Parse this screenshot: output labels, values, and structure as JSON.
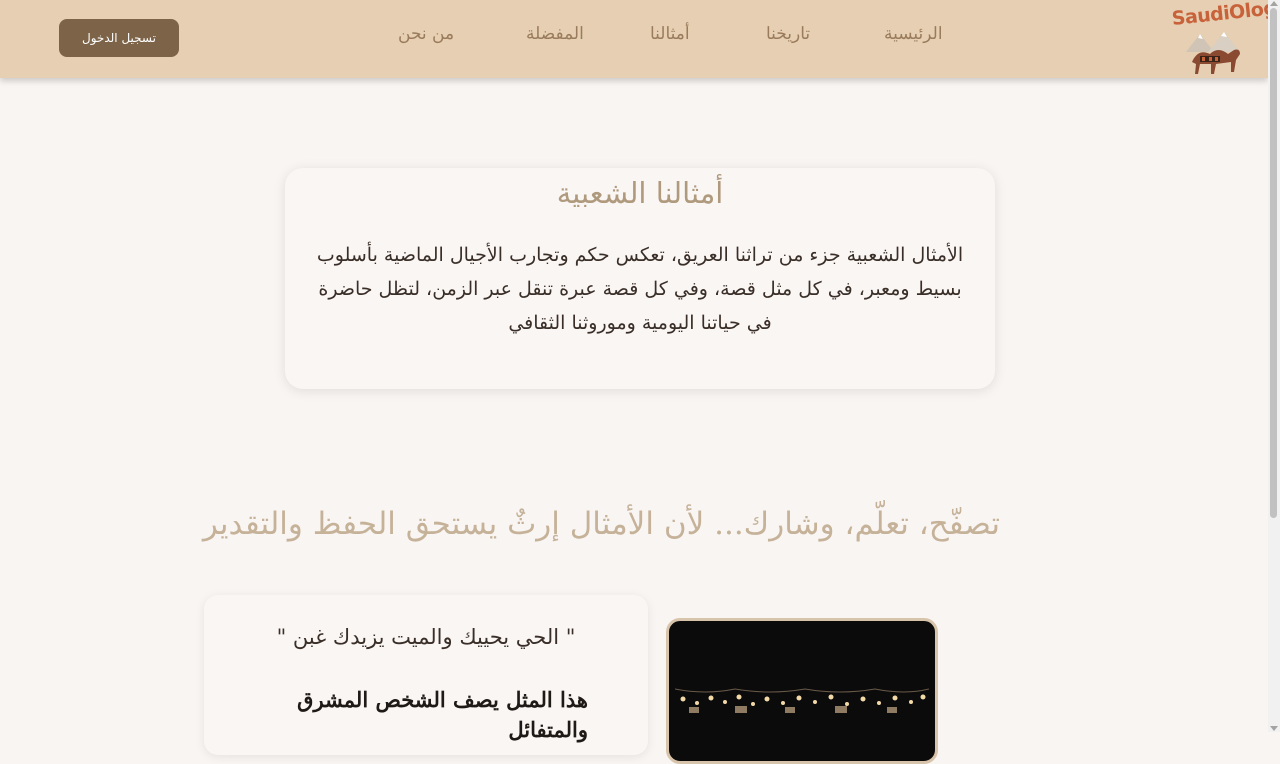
{
  "header": {
    "login_label": "تسجيل الدخول",
    "nav": [
      "من نحن",
      "المفضلة",
      "أمثالنا",
      "تاريخنا",
      "الرئيسية"
    ],
    "logo_text": "SaudiOlogy"
  },
  "intro": {
    "title": "أمثالنا الشعبية",
    "text": "الأمثال الشعبية جزء من تراثنا العريق، تعكس حكم وتجارب الأجيال الماضية بأسلوب بسيط ومعبر، في كل مثل قصة، وفي كل قصة عبرة تنقل عبر الزمن، لتظل حاضرة في حياتنا اليومية وموروثنا الثقافي"
  },
  "tagline": "تصفّح، تعلّم، وشارك... لأن الأمثال إرثٌ يستحق الحفظ والتقدير",
  "proverb": {
    "quote": "\" الحي يحييك والميت يزيدك غبن \"",
    "description": "هذا المثل يصف الشخص المشرق والمتفائل"
  },
  "colors": {
    "header_bg": "#e6cfb2",
    "button_bg": "#7d6448",
    "page_bg": "#f9f5f3",
    "logo_accent": "#c8623a"
  }
}
